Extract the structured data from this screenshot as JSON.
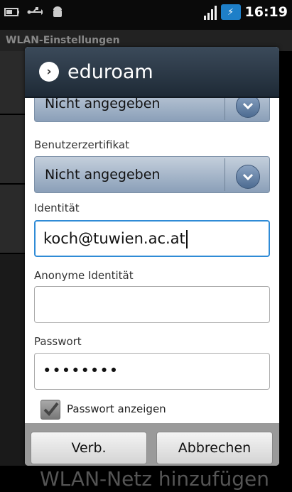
{
  "statusbar": {
    "icons": [
      "battery-charging-icon",
      "usb-icon",
      "android-icon"
    ],
    "time": "16:19"
  },
  "background": {
    "section_header": "WLAN-Einstellungen",
    "bottom_item": "WLAN-Netz hinzufügen"
  },
  "dialog": {
    "title": "eduroam",
    "first_select_value": "Nicht angegeben",
    "certificate": {
      "label": "Benutzerzertifikat",
      "value": "Nicht angegeben"
    },
    "identity": {
      "label": "Identität",
      "value": "koch@tuwien.ac.at"
    },
    "anonymous_identity": {
      "label": "Anonyme Identität",
      "value": ""
    },
    "password": {
      "label": "Passwort",
      "value": "••••••••"
    },
    "show_password": {
      "label": "Passwort anzeigen",
      "checked": true
    },
    "buttons": {
      "connect": "Verb.",
      "cancel": "Abbrechen"
    }
  },
  "colors": {
    "header_bg": "#2b3a4a",
    "focus": "#2f8bd6",
    "battery": "#1e7fc8"
  }
}
